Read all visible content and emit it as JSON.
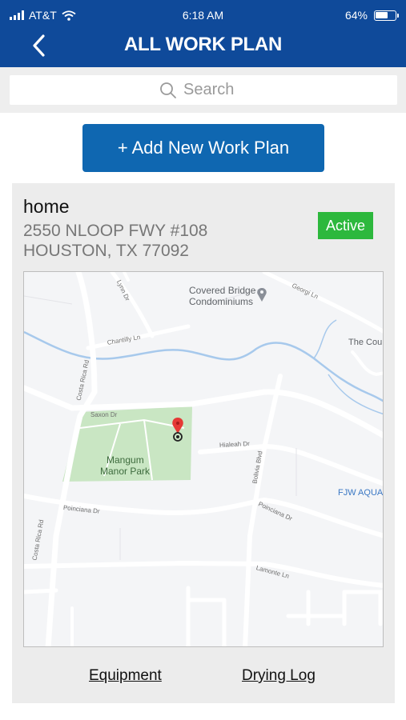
{
  "status_bar": {
    "carrier": "AT&T",
    "time": "6:18 AM",
    "battery": "64%"
  },
  "header": {
    "title": "ALL WORK PLAN"
  },
  "search": {
    "placeholder": "Search"
  },
  "add_button": {
    "label": "+ Add New Work Plan"
  },
  "work_plan": {
    "name": "home",
    "address_line1": "2550 NLOOP FWY #108",
    "address_line2": "HOUSTON, TX 77092",
    "status": "Active",
    "map": {
      "poi": "Covered Bridge Condominiums",
      "poi_line1": "Covered Bridge",
      "poi_line2": "Condominiums",
      "park_line1": "Mangum",
      "park_line2": "Manor Park",
      "business_1": "The Cou",
      "business_2": "FJW AQUA",
      "streets": {
        "lynn": "Lynn Dr",
        "george": "Georgi Ln",
        "chantilly": "Chantilly Ln",
        "costa_rica_1": "Costa Rica Rd",
        "costa_rica_2": "Costa Rica Rd",
        "saxon": "Saxon Dr",
        "hialeah": "Hialeah Dr",
        "bolivia": "Bolivia Blvd",
        "poinciana_1": "Poinciana Dr",
        "poinciana_2": "Poinciana Dr",
        "lamonte": "Lamonte Ln"
      }
    },
    "links": {
      "equipment": "Equipment",
      "drying_log": "Drying Log"
    }
  },
  "colors": {
    "header": "#0f4a9a",
    "button": "#0f67b1",
    "active": "#2db83d",
    "park": "#c9e6c3",
    "water": "#9cc4eb"
  },
  "icons": [
    "signal-icon",
    "wifi-icon",
    "battery-icon",
    "back-chevron-icon",
    "search-icon",
    "map-pin-icon",
    "location-target-icon"
  ]
}
